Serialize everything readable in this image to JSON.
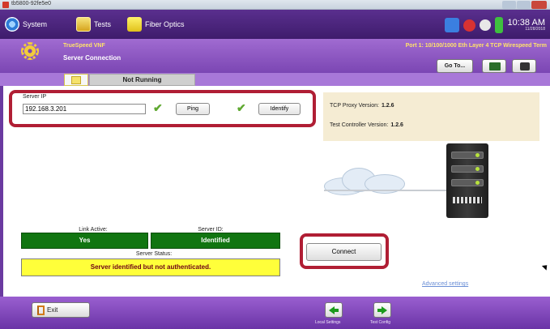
{
  "window": {
    "title": "tb5800-92fe5e0",
    "app_icon": "app-logo-icon"
  },
  "menubar": {
    "items": [
      {
        "label": "System",
        "icon": "globe-icon"
      },
      {
        "label": "Tests",
        "icon": "tests-icon"
      },
      {
        "label": "Fiber Optics",
        "icon": "fiber-optics-icon"
      }
    ],
    "status_icons": [
      "network-icon",
      "alarm-icon",
      "volume-icon",
      "battery-icon"
    ],
    "clock": {
      "time": "10:38 AM",
      "date": "11/28/2018"
    }
  },
  "header": {
    "app_name": "TrueSpeed VNF",
    "screen_name": "Server Connection",
    "port_label": "Port 1: 10/100/1000 Eth Layer 4 TCP Wirespeed Term",
    "goto_label": "Go To..."
  },
  "tab": {
    "status": "Not Running"
  },
  "server": {
    "ip_label": "Server IP",
    "ip_value": "192.168.3.201",
    "ping_label": "Ping",
    "identify_label": "Identify"
  },
  "versions": {
    "tcp_proxy_label": "TCP Proxy Version:",
    "tcp_proxy_value": "1.2.6",
    "controller_label": "Test Controller Version:",
    "controller_value": "1.2.6"
  },
  "status": {
    "link_active_label": "Link Active:",
    "link_active_value": "Yes",
    "server_id_label": "Server ID:",
    "server_id_value": "Identified",
    "server_status_label": "Server Status:",
    "server_status_value": "Server identified but not authenticated."
  },
  "actions": {
    "connect_label": "Connect",
    "advanced_label": "Advanced settings"
  },
  "footer": {
    "exit_label": "Exit",
    "local_settings_label": "Local Settings",
    "test_config_label": "Test Config"
  },
  "colors": {
    "menubar": "#4a2480",
    "header": "#8a55c2",
    "status_green": "#117511",
    "status_yellow": "#ffff3a",
    "highlight_red": "#b01e34",
    "check_green": "#5fa830"
  }
}
